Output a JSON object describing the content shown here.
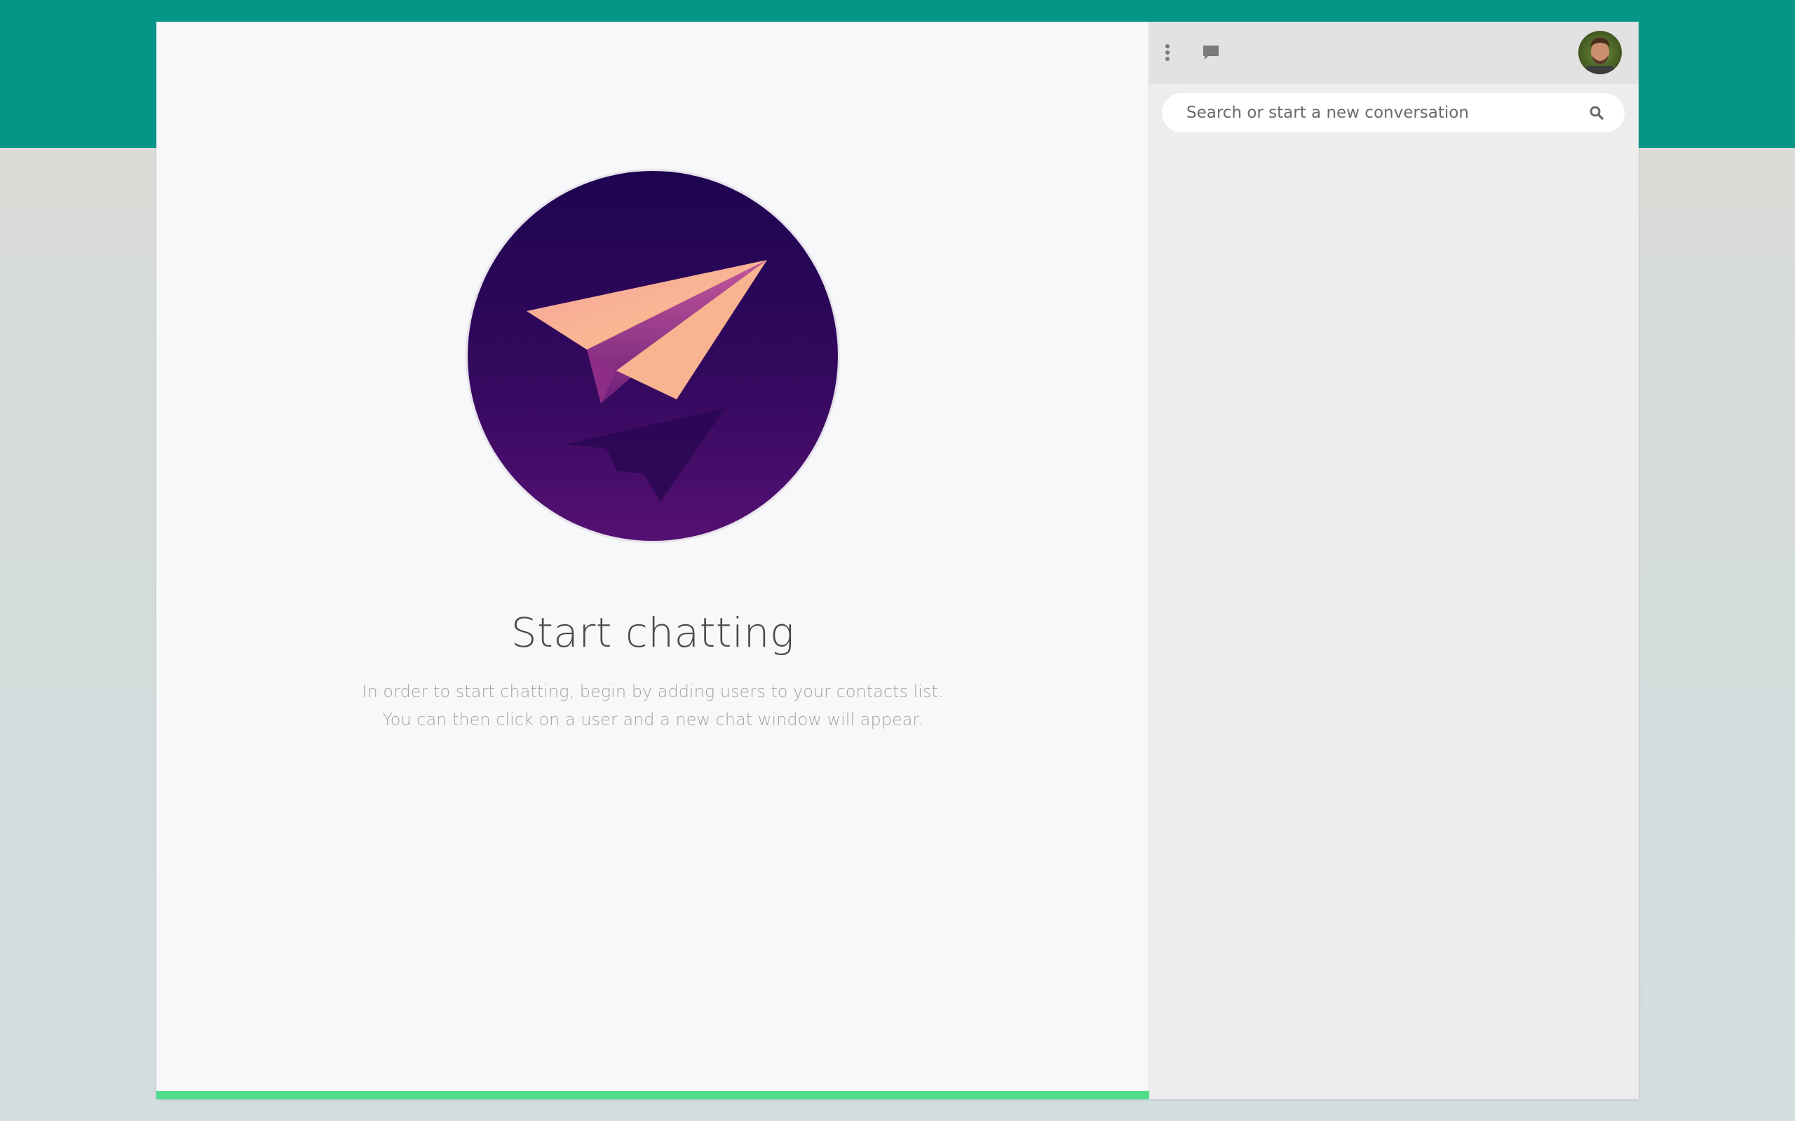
{
  "welcome": {
    "title": "Start chatting",
    "description_line1": "In order to start chatting, begin by adding users to your contacts list.",
    "description_line2": "You can then click on a user and a new chat window will appear.",
    "illustration_icon": "paper-plane-icon"
  },
  "sidebar": {
    "header": {
      "menu_icon": "vertical-dots-icon",
      "new_chat_icon": "chat-bubble-icon",
      "avatar_icon": "user-avatar"
    },
    "search": {
      "placeholder": "Search or start a new conversation",
      "value": "",
      "icon": "search-icon"
    }
  },
  "colors": {
    "top_band": "#069688",
    "accent_bar": "#4fdc8b",
    "hero_gradient_top": "#1e0450",
    "hero_gradient_bottom": "#510f70",
    "plane_peach": "#f7a996",
    "sidebar_bg": "#ededed"
  }
}
